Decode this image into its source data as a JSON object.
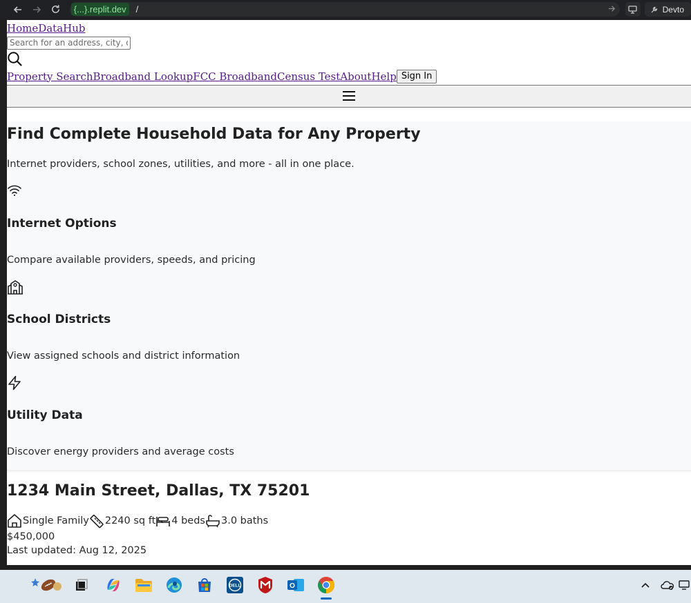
{
  "browser": {
    "url_chip": "{...}.replit.dev",
    "url_path": "/",
    "devtools_label": "Devto"
  },
  "site": {
    "brand": "HomeDataHub",
    "search_placeholder": "Search for an address, city, or zip",
    "nav": [
      {
        "label": "Property Search"
      },
      {
        "label": "Broadband Lookup"
      },
      {
        "label": "FCC Broadband"
      },
      {
        "label": "Census Test"
      },
      {
        "label": "About"
      },
      {
        "label": "Help"
      }
    ],
    "signin_label": "Sign In"
  },
  "hero": {
    "title": "Find Complete Household Data for Any Property",
    "tagline": "Internet providers, school zones, utilities, and more - all in one place.",
    "features": [
      {
        "icon": "wifi-icon",
        "title": "Internet Options",
        "description": "Compare available providers, speeds, and pricing"
      },
      {
        "icon": "school-icon",
        "title": "School Districts",
        "description": "View assigned schools and district information"
      },
      {
        "icon": "lightning-icon",
        "title": "Utility Data",
        "description": "Discover energy providers and average costs"
      }
    ]
  },
  "property": {
    "address": "1234 Main Street, Dallas, TX 75201",
    "type": "Single Family",
    "sqft": "2240 sq ft",
    "beds": "4 beds",
    "baths": "3.0 baths",
    "price": "$450,000",
    "updated": "Last updated: Aug 12, 2025"
  },
  "taskbar": {
    "apps": [
      "widgets-icon",
      "task-view-icon",
      "copilot-icon",
      "file-explorer-icon",
      "edge-icon",
      "store-icon",
      "dell-icon",
      "mcafee-icon",
      "outlook-icon",
      "chrome-icon"
    ],
    "tray": [
      "chevron-up-icon",
      "onedrive-icon",
      "display-icon"
    ]
  },
  "colors": {
    "link": "#551a8b",
    "hero_bg": "#f8f9fa",
    "browser_bg": "#202124",
    "taskbar_bg": "#dfe7ef"
  }
}
